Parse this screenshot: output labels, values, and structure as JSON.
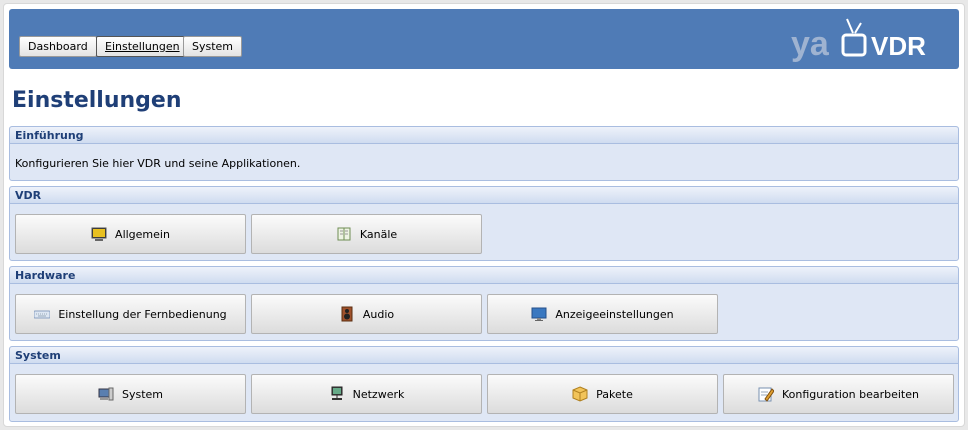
{
  "nav": {
    "items": [
      {
        "label": "Dashboard"
      },
      {
        "label": "Einstellungen"
      },
      {
        "label": "System"
      }
    ]
  },
  "logo": {
    "text_left": "ya",
    "text_right": "VDR"
  },
  "page": {
    "title": "Einstellungen"
  },
  "sections": {
    "intro": {
      "title": "Einführung",
      "text": "Konfigurieren Sie hier VDR und seine Applikationen."
    },
    "vdr": {
      "title": "VDR",
      "items": [
        {
          "label": "Allgemein",
          "icon": "monitor-icon"
        },
        {
          "label": "Kanäle",
          "icon": "book-icon"
        }
      ]
    },
    "hardware": {
      "title": "Hardware",
      "items": [
        {
          "label": "Einstellung der Fernbedienung",
          "icon": "keyboard-icon"
        },
        {
          "label": "Audio",
          "icon": "speaker-icon"
        },
        {
          "label": "Anzeigeeinstellungen",
          "icon": "display-icon"
        }
      ]
    },
    "system": {
      "title": "System",
      "items": [
        {
          "label": "System",
          "icon": "computer-icon"
        },
        {
          "label": "Netzwerk",
          "icon": "network-icon"
        },
        {
          "label": "Pakete",
          "icon": "package-icon"
        },
        {
          "label": "Konfiguration bearbeiten",
          "icon": "edit-icon"
        }
      ]
    }
  },
  "colors": {
    "header": "#4f7bb6",
    "title": "#1f3f77",
    "section_bg": "#dfe7f5"
  }
}
